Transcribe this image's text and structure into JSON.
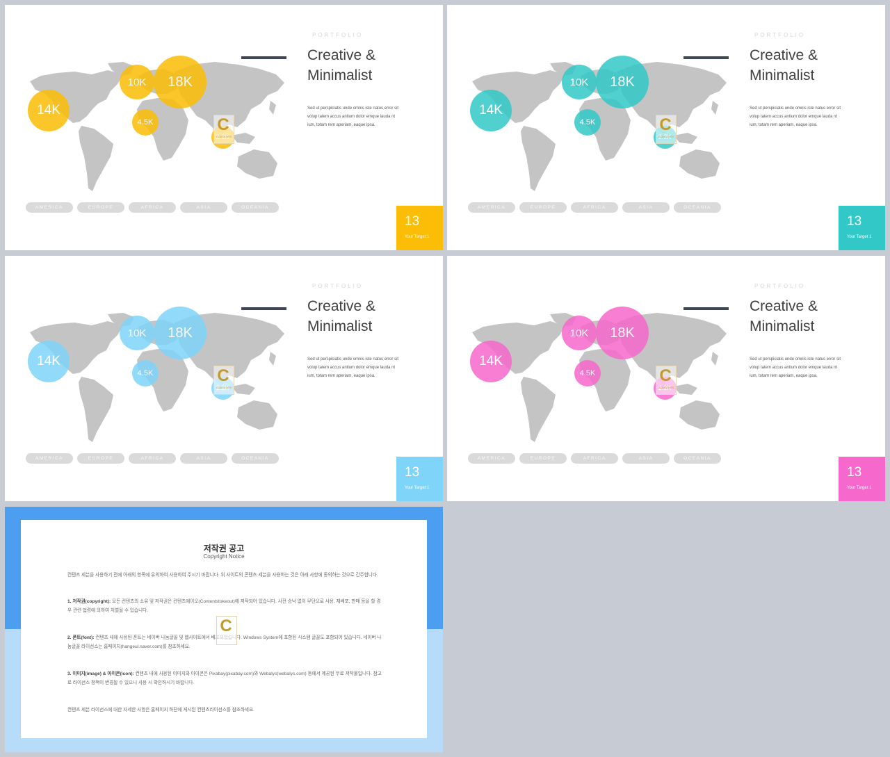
{
  "colors": {
    "background": "#c7cbd3",
    "map_land": "#c4c4c4",
    "rule": "#3d4654",
    "pill_bg": "#dadada",
    "notice_top": "#4c9ff0",
    "notice_bottom": "#b6dcfa"
  },
  "slides": [
    {
      "accent": "#fbbd05",
      "portfolio": "PORTFOLIO",
      "title_line1": "Creative &",
      "title_line2": "Minimalist",
      "body_line1": "Sed ut perspiciatis unde omnis iste natus error sit",
      "body_line2": "volup tatem accus antium dolor emque lauda nt",
      "body_line3": "ium, totam rem aperiam, eaque ipsa.",
      "bubbles": [
        "14K",
        "10K",
        "18K",
        "4.5K",
        "2.2K"
      ],
      "regions": [
        "AMERICA",
        "EUROPE",
        "AFRICA",
        "ASIA",
        "OCEANIA"
      ],
      "number": "13",
      "number_sub": "Your Target 1"
    },
    {
      "accent": "#33c8c8",
      "portfolio": "PORTFOLIO",
      "title_line1": "Creative &",
      "title_line2": "Minimalist",
      "body_line1": "Sed ut perspiciatis unde omnis iste natus error sit",
      "body_line2": "volup tatem accus antium dolor emque lauda nt",
      "body_line3": "ium, totam rem aperiam, eaque ipsa.",
      "bubbles": [
        "14K",
        "10K",
        "18K",
        "4.5K",
        "2.2K"
      ],
      "regions": [
        "AMERICA",
        "EUROPE",
        "AFRICA",
        "ASIA",
        "OCEANIA"
      ],
      "number": "13",
      "number_sub": "Your Target 1"
    },
    {
      "accent": "#7fd4fa",
      "portfolio": "PORTFOLIO",
      "title_line1": "Creative &",
      "title_line2": "Minimalist",
      "body_line1": "Sed ut perspiciatis unde omnis iste natus error sit",
      "body_line2": "volup tatem accus antium dolor emque lauda nt",
      "body_line3": "ium, totam rem aperiam, eaque ipsa.",
      "bubbles": [
        "14K",
        "10K",
        "18K",
        "4.5K",
        "2.2K"
      ],
      "regions": [
        "AMERICA",
        "EUROPE",
        "AFRICA",
        "ASIA",
        "OCEANIA"
      ],
      "number": "13",
      "number_sub": "Your Target 1"
    },
    {
      "accent": "#f768cc",
      "portfolio": "PORTFOLIO",
      "title_line1": "Creative &",
      "title_line2": "Minimalist",
      "body_line1": "Sed ut perspiciatis unde omnis iste natus error sit",
      "body_line2": "volup tatem accus antium dolor emque lauda nt",
      "body_line3": "ium, totam rem aperiam, eaque ipsa.",
      "bubbles": [
        "14K",
        "10K",
        "18K",
        "4.5K",
        "2.2K"
      ],
      "regions": [
        "AMERICA",
        "EUROPE",
        "AFRICA",
        "ASIA",
        "OCEANIA"
      ],
      "number": "13",
      "number_sub": "Your Target 1"
    }
  ],
  "notice": {
    "title": "저작권 공고",
    "subtitle": "Copyright Notice",
    "intro": "컨텐츠 세븐을 사용하기 전에 아래의 항목에 유의하여 사용하여 주시기 바랍니다. 위 사이트의 콘텐츠 세븐을 사용하는 것은 아래 사항에 동의하는 것으로 간주합니다.",
    "s1_head": "1. 저작권(copyright):",
    "s1_text": "모든 컨텐츠의 소유 및 저작권은 컨텐츠에이오(Contentstokeout)에 저작되어 있습니다. 사전 승낙 없이 무단으로 사용, 재배포, 판매 등을 할 경우 관련 법령에 의하여 처벌될 수 있습니다.",
    "s2_head": "2. 폰트(font):",
    "s2_text": "컨텐츠 내에 사용된 폰트는 네이버 나눔글꼴 및 웹사이트에서 배포되었습니다. Windows System에 포함된 시스템 글꼴도 포함되어 있습니다. 네이버 나눔글꼴 라이선스는 홈페이지(hangeul.naver.com)를 참조하세요.",
    "s3_head": "3. 이미지(image) & 아이콘(icon):",
    "s3_text": "컨텐츠 내에 사용된 이미지와 아이콘은 Pixabay(pixabay.com)와 Webalys(webalys.com) 등에서 제공된 무료 저작물입니다. 참고로 라이선스 정책이 변경될 수 있으니 사용 시 확인하시기 바랍니다.",
    "outro": "컨텐츠 세븐 라이선스에 대한 자세한 사항은 홈페이지 하단에 게시된 컨텐츠라이선스를 참조하세요."
  }
}
